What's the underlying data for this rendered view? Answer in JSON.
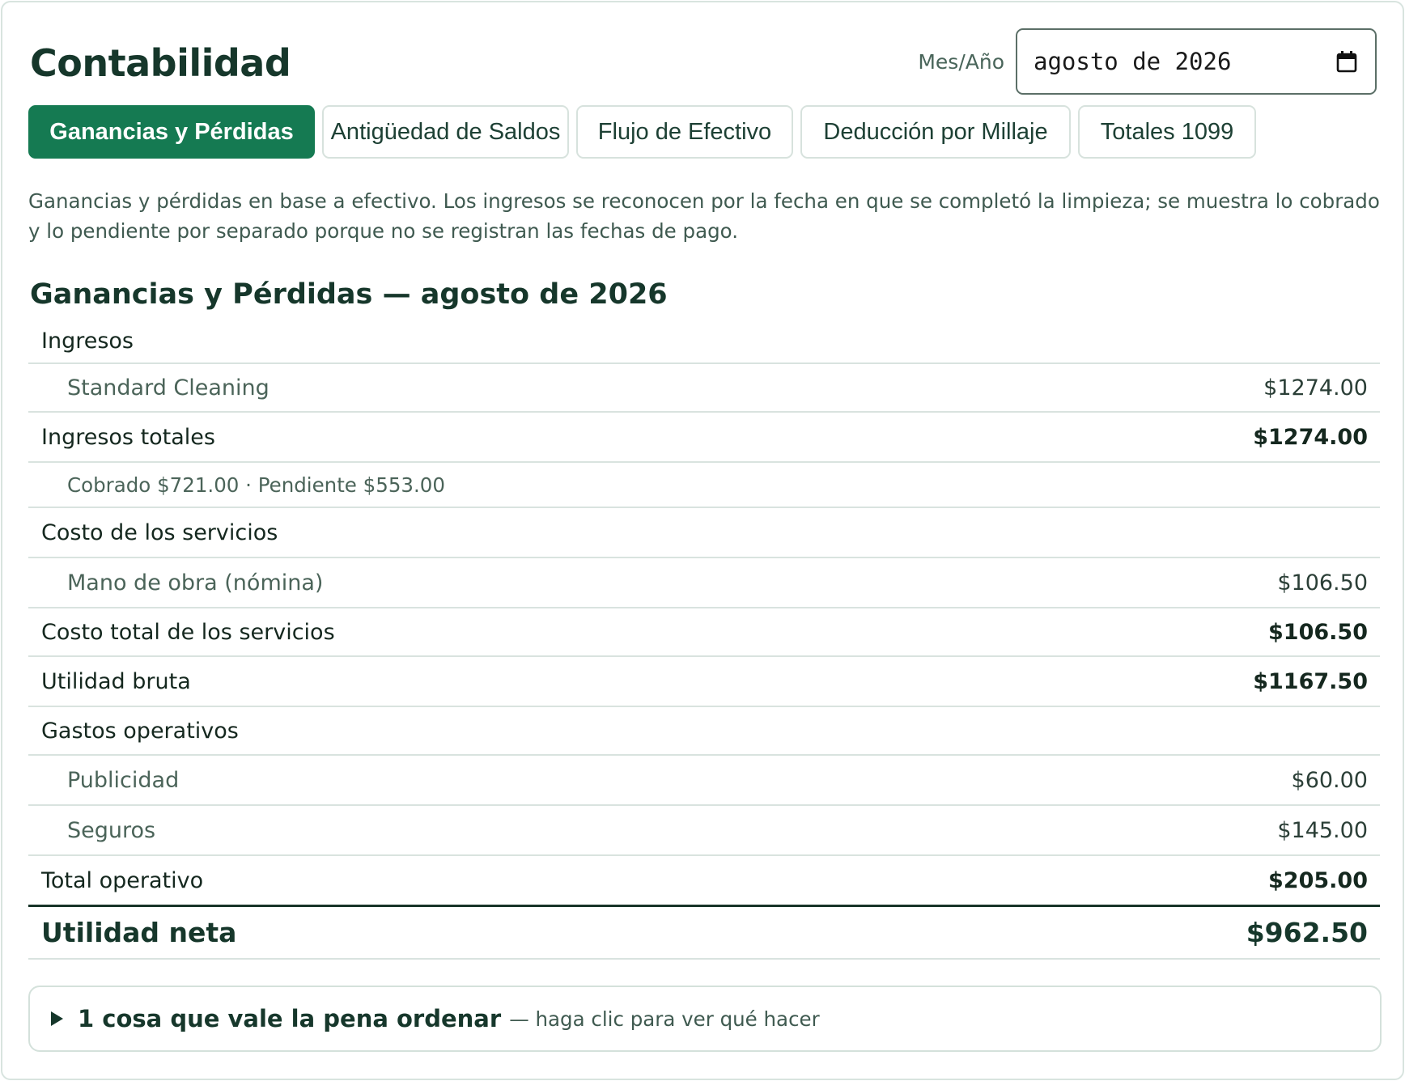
{
  "header": {
    "title": "Contabilidad",
    "month_label": "Mes/Año",
    "month_value": "agosto de 2026"
  },
  "tabs": [
    {
      "label": "Ganancias y Pérdidas",
      "active": true
    },
    {
      "label": "Antigüedad de Saldos",
      "active": false
    },
    {
      "label": "Flujo de Efectivo",
      "active": false
    },
    {
      "label": "Deducción por Millaje",
      "active": false
    },
    {
      "label": "Totales 1099",
      "active": false
    }
  ],
  "description": "Ganancias y pérdidas en base a efectivo. Los ingresos se reconocen por la fecha en que se completó la limpieza; se muestra lo cobrado y lo pendiente por separado porque no se registran las fechas de pago.",
  "report": {
    "title": "Ganancias y Pérdidas — agosto de 2026",
    "rows": {
      "ingresos": {
        "label": "Ingresos"
      },
      "standard_cleaning": {
        "label": "Standard Cleaning",
        "amount": "$1274.00"
      },
      "ingresos_totales": {
        "label": "Ingresos totales",
        "amount": "$1274.00"
      },
      "cobrado_note": {
        "label": "Cobrado $721.00 · Pendiente $553.00"
      },
      "costo_servicios": {
        "label": "Costo de los servicios"
      },
      "mano_obra": {
        "label": "Mano de obra (nómina)",
        "amount": "$106.50"
      },
      "costo_total": {
        "label": "Costo total de los servicios",
        "amount": "$106.50"
      },
      "utilidad_bruta": {
        "label": "Utilidad bruta",
        "amount": "$1167.50"
      },
      "gastos_operativos": {
        "label": "Gastos operativos"
      },
      "publicidad": {
        "label": "Publicidad",
        "amount": "$60.00"
      },
      "seguros": {
        "label": "Seguros",
        "amount": "$145.00"
      },
      "total_operativo": {
        "label": "Total operativo",
        "amount": "$205.00"
      },
      "utilidad_neta": {
        "label": "Utilidad neta",
        "amount": "$962.50"
      }
    }
  },
  "help": {
    "strong": "1 cosa que vale la pena ordenar",
    "rest": "— haga clic para ver qué hacer"
  },
  "colors": {
    "accent": "#157a52",
    "text_dark": "#16372b"
  }
}
